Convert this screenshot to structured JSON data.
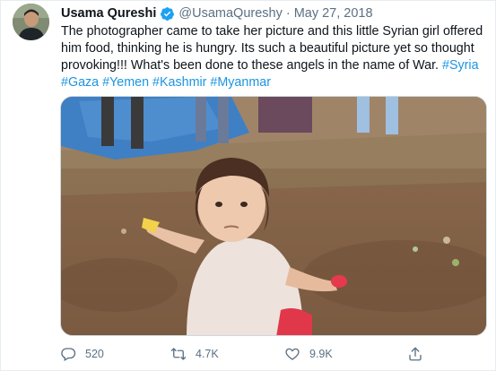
{
  "tweet": {
    "author_name": "Usama Qureshi",
    "handle": "@UsamaQureshy",
    "separator": "·",
    "date": "May 27, 2018",
    "text_line1": "The photographer came to take her picture and this little Syrian girl offered",
    "text_line2": "him food, thinking he is hungry. Its such a beautiful picture yet so thought",
    "text_line3_plain": "provoking!!! What's been done to these angels in the name of War. ",
    "hashtags_line3": [
      "#Syria"
    ],
    "hashtags_line4": [
      "#Gaza",
      "#Yemen",
      "#Kashmir",
      "#Myanmar"
    ]
  },
  "actions": {
    "reply_count": "520",
    "retweet_count": "4.7K",
    "like_count": "9.9K"
  },
  "icons": {
    "verified": "verified-badge-icon",
    "reply": "reply-icon",
    "retweet": "retweet-icon",
    "like": "heart-icon",
    "share": "share-icon"
  },
  "colors": {
    "link": "#1b95e0",
    "muted": "#5b7083",
    "verified": "#1da1f2"
  }
}
